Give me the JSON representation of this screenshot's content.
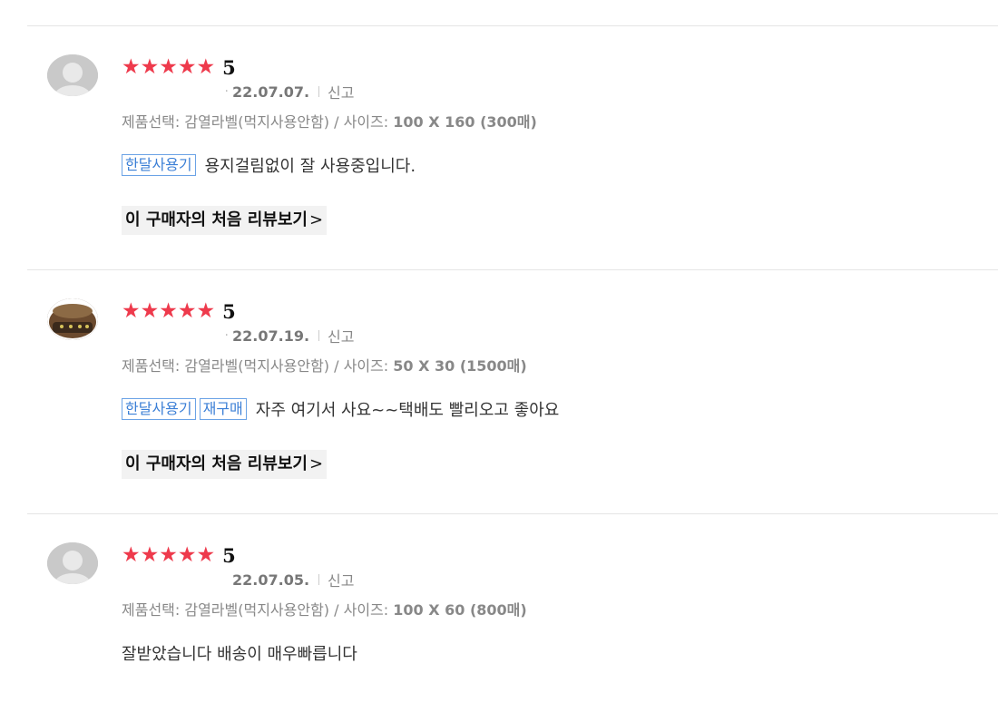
{
  "reviews": [
    {
      "avatar": "default-user-icon",
      "stars": "★★★★★",
      "score": "5",
      "nick_masked": "·",
      "date": "22.07.07.",
      "report": "신고",
      "option_prefix": "제품선택: 감열라벨(먹지사용안함) / 사이즈: ",
      "option_size": "100 X 160 (300매)",
      "tags": [
        "한달사용기"
      ],
      "text": "용지걸림없이 잘 사용중입니다.",
      "first_review_link": "이 구매자의 처음 리뷰보기",
      "first_review_chevron": ">"
    },
    {
      "avatar": "photo-avatar-icon",
      "stars": "★★★★★",
      "score": "5",
      "nick_masked": "·",
      "date": "22.07.19.",
      "report": "신고",
      "option_prefix": "제품선택: 감열라벨(먹지사용안함) / 사이즈: ",
      "option_size": "50 X 30 (1500매)",
      "tags": [
        "한달사용기",
        "재구매"
      ],
      "text": "자주 여기서 사요~~택배도 빨리오고 좋아요",
      "first_review_link": "이 구매자의 처음 리뷰보기",
      "first_review_chevron": ">"
    },
    {
      "avatar": "default-user-icon",
      "stars": "★★★★★",
      "score": "5",
      "nick_masked": "",
      "date": "22.07.05.",
      "report": "신고",
      "option_prefix": "제품선택: 감열라벨(먹지사용안함) / 사이즈: ",
      "option_size": "100 X 60 (800매)",
      "tags": [],
      "text": "잘받았습니다 배송이 매우빠릅니다"
    }
  ],
  "colors": {
    "star": "#ee3a4c",
    "tag_border": "#6ba3e6",
    "tag_text": "#3b7fd6",
    "divider": "#e5e5e5"
  }
}
